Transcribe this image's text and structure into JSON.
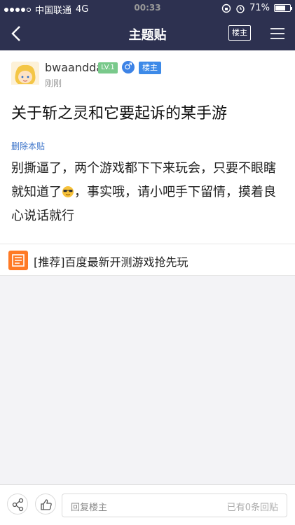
{
  "status_bar": {
    "carrier": "中国联通",
    "network": "4G",
    "time": "00:33",
    "battery_text": "71%",
    "battery_level": 0.71
  },
  "nav": {
    "title": "主题贴",
    "op_button": "楼主",
    "back_icon": "chevron-left-icon",
    "menu_icon": "menu-icon"
  },
  "post": {
    "username": "bwaandda",
    "level": "LV.1",
    "gender_icon": "male-icon",
    "op_badge": "楼主",
    "time": "刚刚",
    "title": "关于斩之灵和它要起诉的某手游",
    "delete_link": "删除本贴",
    "content_before_emoji": "别撕逼了，两个游戏都下下来玩会，只要不眼瞎就知道了",
    "emoji_icon": "sunglasses-emoji-icon",
    "content_after_emoji": "，事实哦，请小吧手下留情，摸着良心说话就行"
  },
  "recommend": {
    "text": "[推荐]百度最新开测游戏抢先玩",
    "accent": "#ff7a25"
  },
  "bottom_bar": {
    "share_icon": "share-icon",
    "like_icon": "thumbs-up-icon",
    "reply_placeholder": "回复楼主",
    "reply_count": "已有0条回贴"
  },
  "colors": {
    "header_bg": "#2d3150",
    "op_badge_bg": "#3d8ae8",
    "level_badge_bg": "#79c98b",
    "link": "#3b73c9"
  }
}
